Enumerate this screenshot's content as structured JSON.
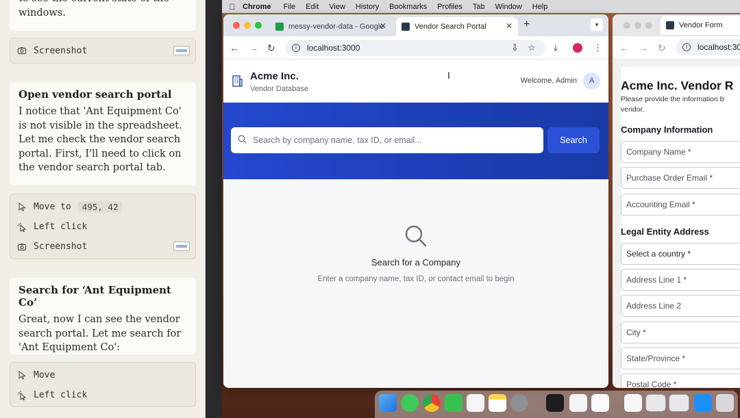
{
  "agent_panel": {
    "top_fragment": "to see the current state of the windows.",
    "steps": [
      {
        "tool": "Screenshot"
      },
      {
        "title": "Open vendor search portal",
        "body": "I notice that 'Ant Equipment Co' is not visible in the spreadsheet. Let me check the vendor search portal. First, I'll need to click on the vendor search portal tab."
      },
      {
        "move_label": "Move to",
        "move_coords": "495, 42",
        "click_label": "Left click",
        "shot_label": "Screenshot"
      },
      {
        "title": "Search for ‘Ant Equipment Co’",
        "body": "Great, now I can see the vendor search portal. Let me search for 'Ant Equipment Co':"
      },
      {
        "move_label": "Move",
        "click_label": "Left click"
      }
    ]
  },
  "menubar": {
    "app": "Chrome",
    "items": [
      "File",
      "Edit",
      "View",
      "History",
      "Bookmarks",
      "Profiles",
      "Tab",
      "Window",
      "Help"
    ]
  },
  "browser": {
    "tabs": [
      {
        "title": "messy-vendor-data - Google",
        "favicon_color": "#1e9e4a"
      },
      {
        "title": "Vendor Search Portal",
        "favicon_color": "#2b3a4a"
      }
    ],
    "url": "localhost:3000",
    "page": {
      "brand_title": "Acme Inc.",
      "brand_subtitle": "Vendor Database",
      "welcome": "Welcome, Admin",
      "avatar_initial": "A",
      "search_placeholder": "Search by company name, tax ID, or email...",
      "search_button": "Search",
      "empty_title": "Search for a Company",
      "empty_subtitle": "Enter a company name, tax ID, or contact email to begin"
    }
  },
  "browser2": {
    "tab_title": "Vendor Form",
    "url": "localhost:300",
    "form_title": "Acme Inc. Vendor R",
    "form_desc": "Please provide the information b vendor.",
    "section_company": "Company Information",
    "fields_company": [
      "Company Name *",
      "Purchase Order Email *",
      "Accounting Email *"
    ],
    "section_address": "Legal Entity Address",
    "fields_address": [
      "Select a country *",
      "Address Line 1 *",
      "Address Line 2",
      "City *",
      "State/Province *",
      "Postal Code *"
    ]
  },
  "colors": {
    "hero_blue": "#2448cf",
    "button_blue": "#2b52d6",
    "panel_bg": "#f1efe8"
  }
}
